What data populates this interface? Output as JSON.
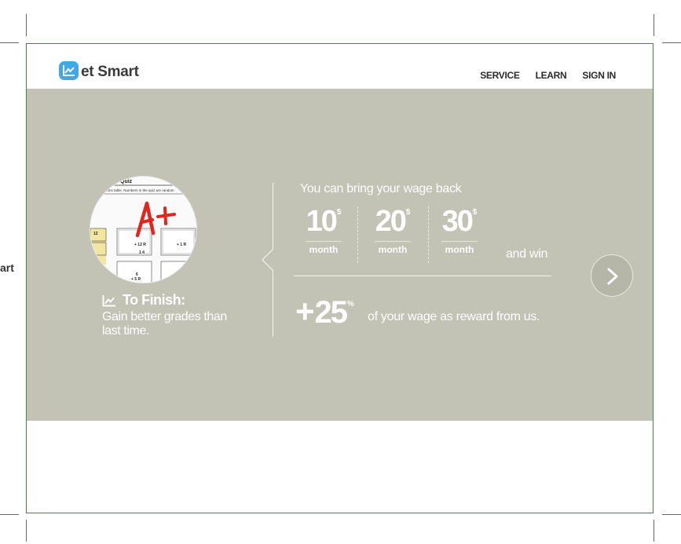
{
  "brand": {
    "name": "et Smart",
    "icon": "chart-icon",
    "color": "#3fa9e8"
  },
  "side_text": "art",
  "nav": {
    "items": [
      "SERVICE",
      "LEARN",
      "SIGN IN"
    ]
  },
  "hero": {
    "background": "#c2c2b5",
    "photo": {
      "icon": "quiz-paper-image",
      "grade": "A+",
      "grade_color": "#e0261d",
      "quiz_title": "Quiz",
      "quiz_subtitle": "items table. Numbers in the quiz are random"
    },
    "finish": {
      "title": "To Finish:",
      "description": "Gain better grades than last time."
    },
    "intro": "You can bring your wage back",
    "amounts": [
      {
        "value": "10",
        "currency": "$",
        "period": "month"
      },
      {
        "value": "20",
        "currency": "$",
        "period": "month"
      },
      {
        "value": "30",
        "currency": "$",
        "period": "month"
      }
    ],
    "and_win": "and win",
    "bonus": {
      "sign": "+",
      "value": "25",
      "unit": "%",
      "text": "of your wage as reward from us."
    },
    "next_icon": "chevron-right-icon"
  }
}
